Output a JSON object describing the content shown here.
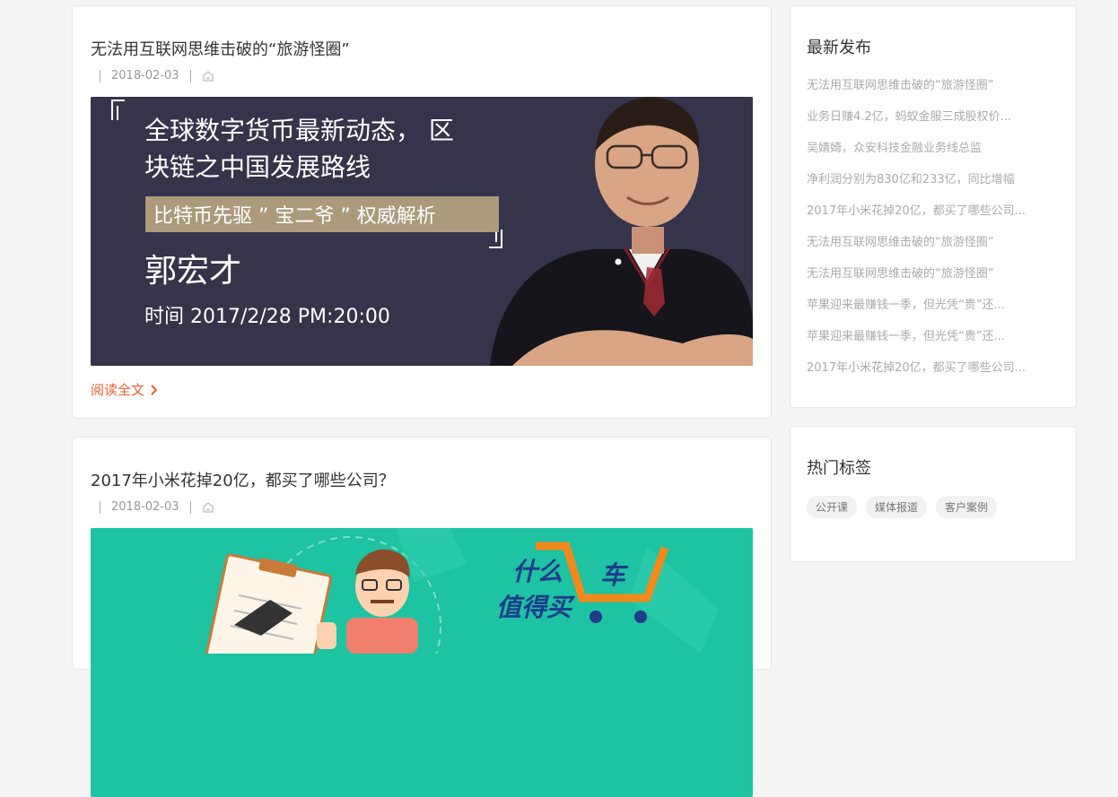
{
  "posts": [
    {
      "title": "无法用互联网思维击破的“旅游怪圈”",
      "date": "2018-02-03",
      "read_more": "阅读全文",
      "banner": {
        "line1": "全球数字货币最新动态，  区",
        "line2": "块链之中国发展路线",
        "highlight": "比特币先驱 ” 宝二爷 ” 权威解析",
        "name": "郭宏才",
        "time": "时间  2017/2/28  PM:20:00"
      }
    },
    {
      "title": "2017年小米花掉20亿，都买了哪些公司？",
      "date": "2018-02-03",
      "banner": {
        "brand_line1": "什么",
        "brand_char": "车",
        "brand_line2": "值得买"
      }
    }
  ],
  "sidebar": {
    "latest_title": "最新发布",
    "latest": [
      "无法用互联网思维击破的“旅游怪圈”",
      "业务日赚4.2亿，蚂蚁金服三成股权价...",
      "吴婧婍，众安科技金融业务线总监",
      "净利润分别为830亿和233亿，同比增幅",
      "2017年小米花掉20亿，都买了哪些公司...",
      "无法用互联网思维击破的“旅游怪圈”",
      "无法用互联网思维击破的“旅游怪圈”",
      "苹果迎来最赚钱一季，但光凭“贵”还...",
      "苹果迎来最赚钱一季，但光凭“贵”还...",
      "2017年小米花掉20亿，都买了哪些公司..."
    ],
    "tags_title": "热门标签",
    "tags": [
      "公开课",
      "媒体报道",
      "客户案例"
    ]
  },
  "colors": {
    "accent": "#e8602e",
    "banner1_bg": "#35344b",
    "banner2_bg": "#1dc3a2"
  }
}
